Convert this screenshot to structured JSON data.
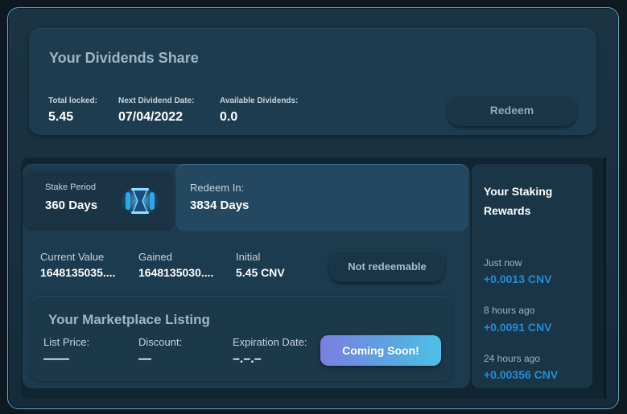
{
  "dividends": {
    "title": "Your Dividends Share",
    "total_locked_label": "Total locked:",
    "total_locked_value": "5.45",
    "next_date_label": "Next Dividend Date:",
    "next_date_value": "07/04/2022",
    "available_label": "Available Dividends:",
    "available_value": "0.0",
    "redeem_label": "Redeem"
  },
  "stake": {
    "period_label": "Stake Period",
    "period_value": "360 Days",
    "redeem_in_label": "Redeem In:",
    "redeem_in_value": "3834 Days",
    "current_value_label": "Current Value",
    "current_value": "1648135035....",
    "gained_label": "Gained",
    "gained_value": "1648135030....",
    "initial_label": "Initial",
    "initial_value": "5.45 CNV",
    "not_redeemable_label": "Not redeemable"
  },
  "marketplace": {
    "title": "Your Marketplace Listing",
    "list_price_label": "List Price:",
    "list_price_value": "——",
    "discount_label": "Discount:",
    "discount_value": "—",
    "expiration_label": "Expiration Date:",
    "expiration_value": "–.–.–",
    "coming_soon_label": "Coming Soon!"
  },
  "rewards": {
    "title": "Your Staking Rewards",
    "items": [
      {
        "time": "Just now",
        "amount": "+0.0013 CNV"
      },
      {
        "time": "8 hours ago",
        "amount": "+0.0091 CNV"
      },
      {
        "time": "24 hours ago",
        "amount": "+0.00356 CNV"
      }
    ]
  },
  "colors": {
    "accent_blue": "#1e8fd6",
    "button_gradient_start": "#7b7fe0",
    "button_gradient_end": "#4fc0e8"
  },
  "icons": {
    "stake_icon": "stake-hourglass-icon"
  }
}
